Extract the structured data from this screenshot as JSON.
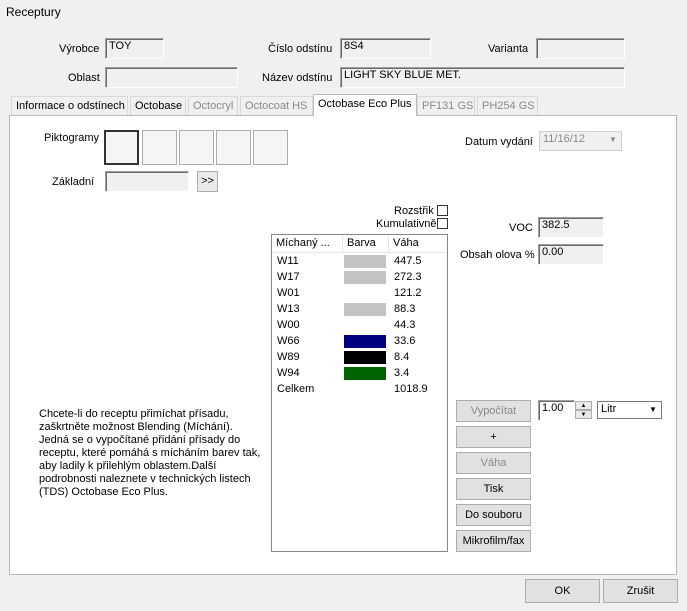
{
  "window": {
    "title": "Receptury"
  },
  "header": {
    "manufacturer_label": "Výrobce",
    "manufacturer_value": "TOY",
    "shade_number_label": "Číslo odstínu",
    "shade_number_value": "8S4",
    "variant_label": "Varianta",
    "variant_value": "",
    "area_label": "Oblast",
    "area_value": "",
    "shade_name_label": "Název odstínu",
    "shade_name_value": "LIGHT SKY BLUE MET."
  },
  "tabs": [
    {
      "label": "Informace o odstínech",
      "state": "enabled"
    },
    {
      "label": "Octobase",
      "state": "enabled"
    },
    {
      "label": "Octocryl",
      "state": "disabled"
    },
    {
      "label": "Octocoat HS",
      "state": "disabled"
    },
    {
      "label": "Octobase Eco Plus",
      "state": "active"
    },
    {
      "label": "PF131 GS",
      "state": "disabled"
    },
    {
      "label": "PH254 GS",
      "state": "disabled"
    }
  ],
  "panel": {
    "pictograms_label": "Piktogramy",
    "basic_label": "Základní",
    "basic_value": "",
    "expand_label": ">>",
    "issue_date_label": "Datum vydání",
    "issue_date_value": "11/16/12",
    "spray_label": "Rozstřik",
    "cumulative_label": "Kumulativně",
    "voc_label": "VOC",
    "voc_value": "382.5",
    "lead_label": "Obsah olova %",
    "lead_value": "0.00",
    "note": "Chcete-li do receptu přimíchat přísadu, zaškrtněte možnost Blending (Míchání). Jedná se o vypočítané přidání přísady do receptu, které pomáhá s mícháním barev tak, aby ladily k přilehlým oblastem.Další podrobnosti naleznete v technických listech (TDS) Octobase Eco Plus."
  },
  "mix_table": {
    "columns": [
      "Míchaný ...",
      "Barva",
      "Váha"
    ],
    "rows": [
      {
        "name": "W11",
        "color": "#c3c3c3",
        "weight": "447.5"
      },
      {
        "name": "W17",
        "color": "#c3c3c3",
        "weight": "272.3"
      },
      {
        "name": "W01",
        "color": "",
        "weight": "121.2"
      },
      {
        "name": "W13",
        "color": "#c3c3c3",
        "weight": "88.3"
      },
      {
        "name": "W00",
        "color": "",
        "weight": "44.3"
      },
      {
        "name": "W66",
        "color": "#000080",
        "weight": "33.6"
      },
      {
        "name": "W89",
        "color": "#000000",
        "weight": "8.4"
      },
      {
        "name": "W94",
        "color": "#006400",
        "weight": "3.4"
      },
      {
        "name": "Celkem",
        "color": "",
        "weight": "1018.9"
      }
    ]
  },
  "actions": {
    "calculate_label": "Vypočítat",
    "quantity_value": "1.00",
    "unit_value": "Litr",
    "plus_label": "+",
    "weight_label": "Váha",
    "print_label": "Tisk",
    "to_file_label": "Do souboru",
    "microfile_label": "Mikrofilm/fax"
  },
  "footer": {
    "ok_label": "OK",
    "cancel_label": "Zrušit"
  }
}
